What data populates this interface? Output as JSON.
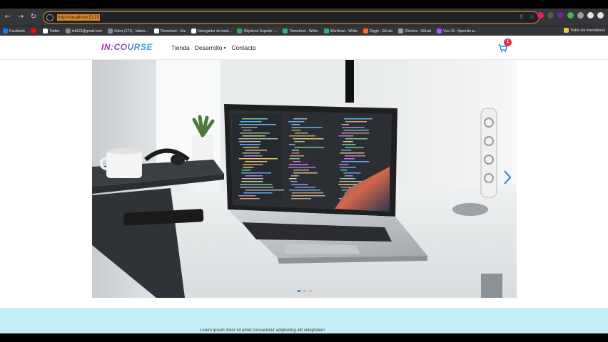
{
  "browser": {
    "url": "http://localhost:5173",
    "bookmarks": [
      {
        "label": "Facebook",
        "color": "#1877f2"
      },
      {
        "label": "",
        "color": "#ff0000"
      },
      {
        "label": "Twitter",
        "color": "#ffffff"
      },
      {
        "label": "ielt123@gmail.com",
        "color": "#8a8a8a"
      },
      {
        "label": "Inbox (171) - laitam...",
        "color": "#8a8a8a"
      },
      {
        "label": "Timesheet - Jira",
        "color": "#ffffff"
      },
      {
        "label": "Navegador de incid...",
        "color": "#ffffff"
      },
      {
        "label": "Objetivos Soporte -...",
        "color": "#34a853"
      },
      {
        "label": "Timesheet - Wrike",
        "color": "#2bb673"
      },
      {
        "label": "Workload - Wrike",
        "color": "#2bb673"
      },
      {
        "label": "Diggit - GitLab",
        "color": "#fc6d26"
      },
      {
        "label": "Clientes - GitLab",
        "color": "#9aa0a6"
      },
      {
        "label": "Vue JS - Aprende a...",
        "color": "#a259ff"
      }
    ],
    "bookmarks_end_label": "Todos los marcadores",
    "ext_colors": [
      "#e91e63",
      "#555555",
      "#7b1fa2",
      "#4caf50",
      "#9aa0a6",
      "#e3e3e3",
      "#e3e3e3"
    ]
  },
  "site": {
    "logo_text_a": "IN",
    "logo_text_b": "COURSE",
    "menu": [
      {
        "label": "Tienda",
        "dropdown": false
      },
      {
        "label": "Desarrollo",
        "dropdown": true
      },
      {
        "label": "Contacto",
        "dropdown": false
      }
    ],
    "cart_count": "1",
    "accent_color": "#0d6efd",
    "brand_gradient": [
      "#b02aa8",
      "#27c3d6"
    ]
  },
  "carousel": {
    "slide_count": 3,
    "active_slide": 1,
    "image_subject": "laptop showing code on desk"
  },
  "footer_band": {
    "text": "Lorem ipsum dolor sit amet consectetur adipisicing elit voluptatem"
  }
}
